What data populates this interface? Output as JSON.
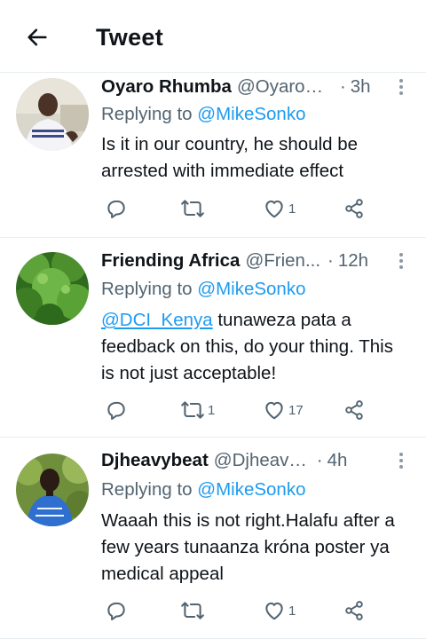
{
  "header": {
    "title": "Tweet",
    "back_icon": "arrow-left-icon"
  },
  "colors": {
    "link": "#1d9bf0",
    "muted": "#536471",
    "text": "#0f1419",
    "divider": "#e6ecf0"
  },
  "replies": [
    {
      "name": "Oyaro Rhumba",
      "handle": "@OyaroR...",
      "time": "3h",
      "replying_prefix": "Replying to",
      "replying_to": "@MikeSonko",
      "body_link": "",
      "body_text": "Is it in our country, he should be arrested with immediate effect",
      "retweet_count": "",
      "like_count": "1"
    },
    {
      "name": "Friending Africa",
      "handle": "@Frien...",
      "time": "12h",
      "replying_prefix": "Replying to",
      "replying_to": "@MikeSonko",
      "body_link": "@DCI_Kenya",
      "body_text": " tunaweza pata a feedback on this, do your thing. This is not just acceptable!",
      "retweet_count": "1",
      "like_count": "17"
    },
    {
      "name": "Djheavybeat",
      "handle": "@Djheavyb...",
      "time": "4h",
      "replying_prefix": "Replying to",
      "replying_to": "@MikeSonko",
      "body_link": "",
      "body_text": "Waaah this is not right.Halafu after a few years tunaanza króna poster ya medical appeal",
      "retweet_count": "",
      "like_count": "1"
    }
  ]
}
